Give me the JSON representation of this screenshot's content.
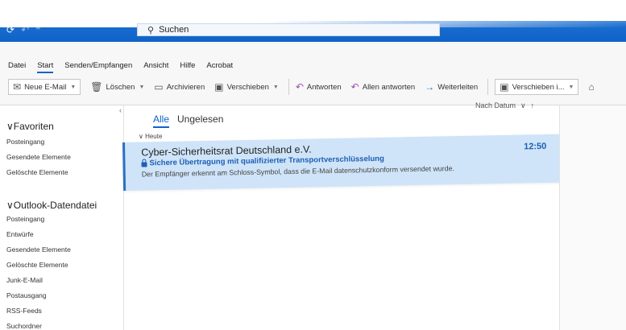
{
  "titlebar": {
    "search_placeholder": "Suchen"
  },
  "ribbon": {
    "tabs": [
      "Datei",
      "Start",
      "Senden/Empfangen",
      "Ansicht",
      "Hilfe",
      "Acrobat"
    ],
    "commands": {
      "new_mail": "Neue E-Mail",
      "delete": "Löschen",
      "archive": "Archivieren",
      "move": "Verschieben",
      "reply": "Antworten",
      "reply_all": "Allen antworten",
      "forward": "Weiterleiten",
      "move_to": "Verschieben i..."
    }
  },
  "nav": {
    "favorites_label": "Favoriten",
    "favorites": [
      "Posteingang",
      "Gesendete Elemente",
      "Gelöschte Elemente"
    ],
    "datafile_label": "Outlook-Datendatei",
    "datafile_items": [
      "Posteingang",
      "Entwürfe",
      "Gesendete Elemente",
      "Gelöschte Elemente",
      "Junk-E-Mail",
      "Postausgang",
      "RSS-Feeds",
      "Suchordner"
    ]
  },
  "list": {
    "filter_all": "Alle",
    "filter_unread": "Ungelesen",
    "sort_label": "Nach Datum",
    "group_today": "Heute",
    "message": {
      "sender": "Cyber-Sicherheitsrat Deutschland e.V.",
      "subject": "Sichere Übertragung mit qualifizierter Transportverschlüsselung",
      "preview": "Der Empfänger erkennt am Schloss-Symbol, dass die E-Mail datenschutzkonform versendet wurde.",
      "time": "12:50"
    }
  },
  "colors": {
    "accent": "#0f63c8",
    "selected_bg": "#cfe4f8"
  }
}
